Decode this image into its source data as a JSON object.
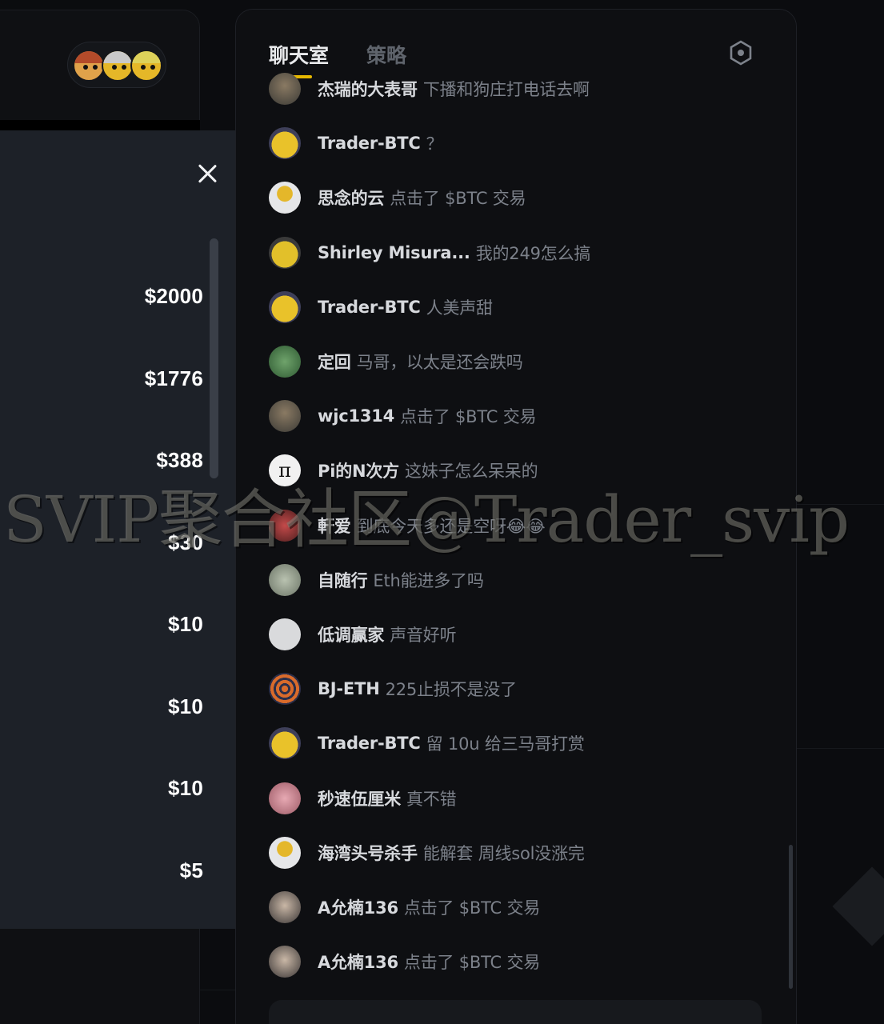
{
  "chat": {
    "tabs": [
      {
        "label": "聊天室",
        "active": true
      },
      {
        "label": "策略",
        "active": false
      }
    ],
    "settings_icon": "hexagon-settings-icon",
    "accent_color": "#e6b800",
    "messages": [
      {
        "user": "杰瑞的大表哥",
        "text": "下播和狗庄打电话去啊",
        "avatar": "photo-avatar"
      },
      {
        "user": "Trader-BTC",
        "text": "？",
        "avatar": "yellow-cartoon-avatar"
      },
      {
        "user": "思念的云",
        "text": "点击了 $BTC 交易",
        "avatar": "default-yellow-avatar"
      },
      {
        "user": "Shirley Misura...",
        "text": "我的249怎么搞",
        "avatar": "sunglasses-cartoon-avatar"
      },
      {
        "user": "Trader-BTC",
        "text": "人美声甜",
        "avatar": "yellow-cartoon-avatar"
      },
      {
        "user": "定回",
        "text": "马哥，以太是还会跌吗",
        "avatar": "green-clover-avatar"
      },
      {
        "user": "wjc1314",
        "text": "点击了 $BTC 交易",
        "avatar": "photo-avatar"
      },
      {
        "user": "Pi的N次方",
        "text": "这妹子怎么呆呆的",
        "avatar": "pi-avatar"
      },
      {
        "user": "軒爱",
        "text": "到底今天多还是空呀😂😂",
        "avatar": "red-avatar"
      },
      {
        "user": "自随行",
        "text": "Eth能进多了吗",
        "avatar": "cartoon-avatar"
      },
      {
        "user": "低调赢家",
        "text": "声音好听",
        "avatar": "bird-avatar"
      },
      {
        "user": "BJ-ETH",
        "text": "225止损不是没了",
        "avatar": "orange-rings-avatar"
      },
      {
        "user": "Trader-BTC",
        "text": "留 10u 给三马哥打赏",
        "avatar": "yellow-cartoon-avatar"
      },
      {
        "user": "秒速伍厘米",
        "text": "真不错",
        "avatar": "pink-avatar"
      },
      {
        "user": "海湾头号杀手",
        "text": "能解套 周线sol没涨完",
        "avatar": "default-yellow-avatar"
      },
      {
        "user": "A允楠136",
        "text": "点击了 $BTC 交易",
        "avatar": "person-photo-avatar"
      },
      {
        "user": "A允楠136",
        "text": "点击了 $BTC 交易",
        "avatar": "person-photo-avatar"
      }
    ]
  },
  "tip_panel": {
    "close_icon": "close-icon",
    "amounts": [
      "$2000",
      "$1776",
      "$388",
      "$30",
      "$10",
      "$10",
      "$10",
      "$5"
    ]
  },
  "watermark": "SVIP聚合社区@Trader_svip"
}
